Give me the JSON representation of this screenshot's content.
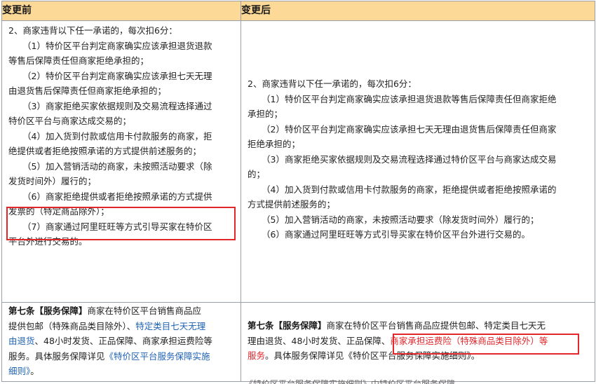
{
  "header": {
    "before": "变更前",
    "after": "变更后"
  },
  "before_rules": [
    "2、商家违背以下任一承诺的，每次扣6分：",
    "（1）特价区平台判定商家确实应该承担退货退款",
    "等售后保障责任但商家拒绝承担的；",
    "（2）特价区平台判定商家确实应该承担七天无理",
    "由退货售后保障责任但商家拒绝承担的；",
    "（3）商家拒绝买家依据规则及交易流程选择通过",
    "特价区平台与商家达成交易的；",
    "（4）加入货到付款或信用卡付款服务的商家，拒",
    "绝提供或者拒绝按照承诺的方式提供前述服务的；",
    "（5）加入营销活动的商家，未按照活动要求（除",
    "发货时间外）履行的；",
    "（6）商家拒绝提供或者拒绝按照承诺的方式提供",
    "发票的（特定商品除外）；",
    "（7）商家通过阿里旺旺等方式引导买家在特价区",
    "平台外进行交易的。"
  ],
  "after_rules": [
    "2、商家违背以下任一承诺的，每次扣6分：",
    "（1）特价区平台判定商家确实应该承担退货退款等售后保障责任但商家拒绝",
    "承担的；",
    "（2）特价区平台判定商家确实应该承担七天无理由退货售后保障责任但商家",
    "拒绝承担的；",
    "（3）商家拒绝买家依据规则及交易流程选择通过特价区平台与商家达成交易",
    "的；",
    "（4）加入货到付款或信用卡付款服务的商家，拒绝提供或者拒绝按照承诺的",
    "方式提供前述服务的；",
    "（5）加入营销活动的商家，未按照活动要求（除发货时间外）履行的；",
    "（6）商家通过阿里旺旺等方式引导买家在特价区平台外进行交易的。"
  ],
  "before_article": {
    "title": "第七条【服务保障】",
    "l1": "商家在特价区平台销售商品应",
    "l2a": "提供包邮（特殊商品类目除外）、",
    "l2b": "特定类目七天无理",
    "l3a": "由退货",
    "l3b": "、48小时发货、正品保障、商家承担运费险等",
    "l4a": "服务。具体服务保障详见",
    "l4b": "《特价区平台服务保障实施",
    "l5a": "细则》",
    "l5b": "。"
  },
  "after_article": {
    "title": "第七条【服务保障】",
    "l1": "商家在特价区平台销售商品应提供包邮、特定类目七天无",
    "l2a": "理由退货、48小时发货、正品保障、",
    "l2b": "商家承担运费险（特殊商品类目除外）等",
    "l3a": "服务",
    "l3b": "。具体服务保障详见《特价区平台服务保障实施细则》。"
  },
  "next_row_partial": "《特价区平台服务保障实施细则》中特价区平台服务保障",
  "colors": {
    "header_bg": "#fcd997",
    "highlight": "#e3262a",
    "link": "#1f62b4",
    "border": "#9aa0a6"
  }
}
